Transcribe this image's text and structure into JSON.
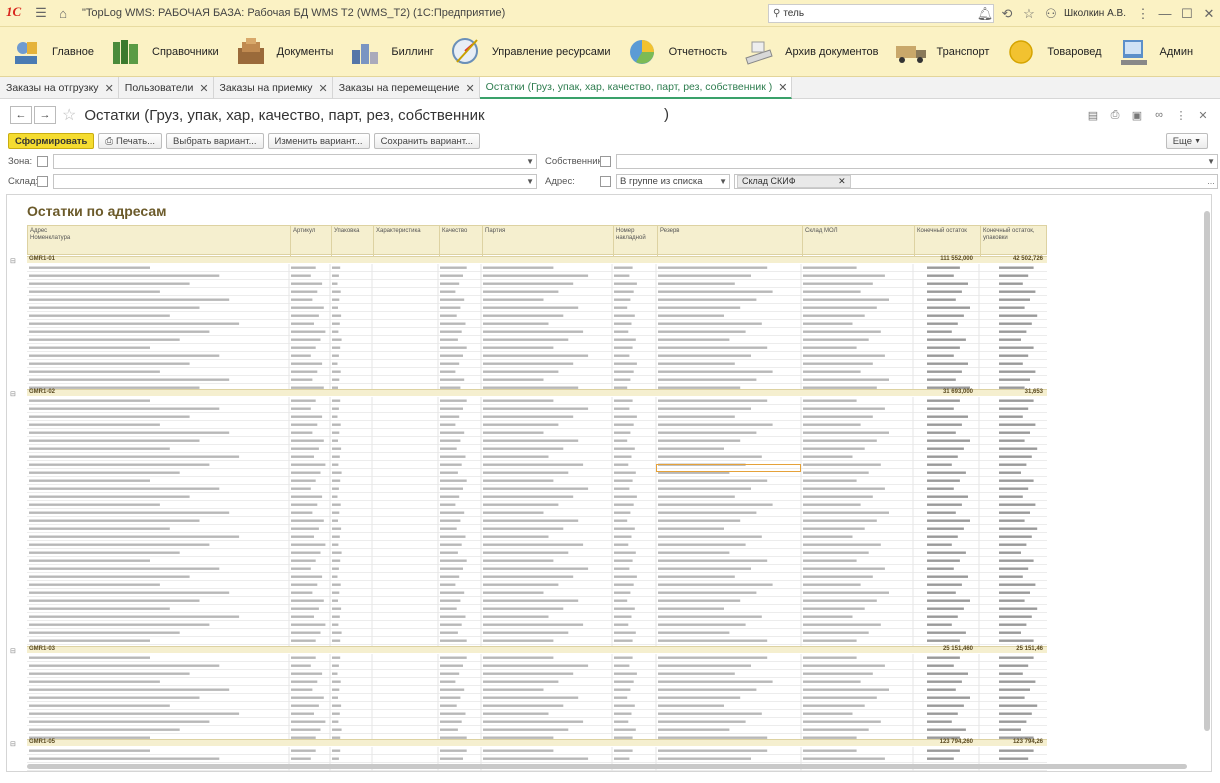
{
  "app": {
    "logo": "1С",
    "title": "\"TopLog WMS: РАБОЧАЯ БАЗА: Рабочая БД WMS T2 (WMS_T2) (1С:Предприятие)",
    "search_value": "тель",
    "user": "Школкин А.В."
  },
  "sections": [
    {
      "label": "Главное",
      "icon": "home-icon"
    },
    {
      "label": "Справочники",
      "icon": "books-icon"
    },
    {
      "label": "Документы",
      "icon": "documents-icon"
    },
    {
      "label": "Биллинг",
      "icon": "billing-icon"
    },
    {
      "label": "Управление ресурсами",
      "icon": "resources-icon"
    },
    {
      "label": "Отчетность",
      "icon": "reports-icon"
    },
    {
      "label": "Архив документов",
      "icon": "archive-icon"
    },
    {
      "label": "Транспорт",
      "icon": "transport-icon"
    },
    {
      "label": "Товаровед",
      "icon": "merchandiser-icon"
    },
    {
      "label": "Админ",
      "icon": "admin-icon"
    }
  ],
  "tabs": [
    {
      "label": "Заказы на отгрузку",
      "active": false
    },
    {
      "label": "Пользователи",
      "active": false
    },
    {
      "label": "Заказы на приемку",
      "active": false
    },
    {
      "label": "Заказы на перемещение",
      "active": false
    },
    {
      "label": "Остатки (Груз, упак, хар, качество, парт, рез, собственник                )",
      "active": true
    }
  ],
  "form": {
    "title": "Остатки (Груз, упак, хар, качество, парт, рез, собственник",
    "title_end": ")"
  },
  "commands": {
    "generate": "Сформировать",
    "print": "Печать...",
    "choose_variant": "Выбрать вариант...",
    "change_variant": "Изменить вариант...",
    "save_variant": "Сохранить вариант...",
    "more": "Еще"
  },
  "filters": {
    "zone_label": "Зона:",
    "warehouse_label": "Склад:",
    "owner_label": "Собственник:",
    "address_label": "Адрес:",
    "address_mode": "В группе из списка",
    "address_chip": "Склад СКИФ"
  },
  "report": {
    "title": "Остатки по адресам",
    "columns": [
      "Адрес",
      "Номенклатура",
      "Артикул",
      "Упаковка",
      "Характеристика",
      "Качество",
      "Партия",
      "Номер накладной",
      "Резерв",
      "Склад МОЛ",
      "Конечный остаток",
      "Конечный остаток, упаковки"
    ],
    "groups": [
      {
        "name": "GMR1-01",
        "total": "111 552,000",
        "total_pack": "42 502,726"
      },
      {
        "name": "GMR1-02",
        "total": "31 693,000",
        "total_pack": "31,653"
      },
      {
        "name": "GMR1-03",
        "total": "25 151,460",
        "total_pack": "25 151,46"
      },
      {
        "name": "GMR1-05",
        "total": "123 794,260",
        "total_pack": "123 794,26"
      }
    ]
  },
  "colors": {
    "accent_yellow": "#f5dc30",
    "panel_yellow": "#fbf2c4",
    "active_tab_green": "#3aa16a"
  }
}
